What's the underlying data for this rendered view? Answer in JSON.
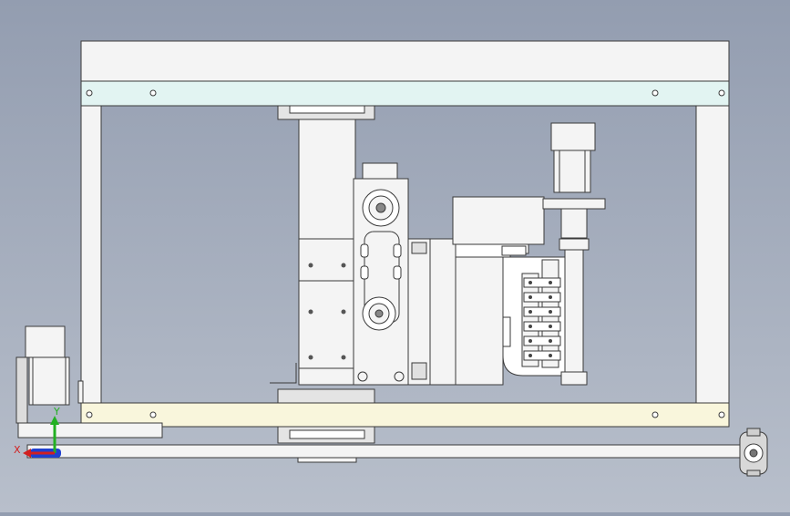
{
  "triad": {
    "x_label": "X",
    "y_label": "Y",
    "x_color": "#d22020",
    "y_color": "#22b022",
    "z_color": "#2040d0"
  },
  "colors": {
    "background_top": "#939db0",
    "background_bottom": "#b8bfcb",
    "beam_top_rail": "#e2f4f2",
    "beam_bottom_rail": "#f9f6dc",
    "part_fill": "#f4f4f4",
    "outline": "#3a3a3a"
  },
  "icons": {
    "coordinate_triad": "xyz-axes-icon"
  }
}
